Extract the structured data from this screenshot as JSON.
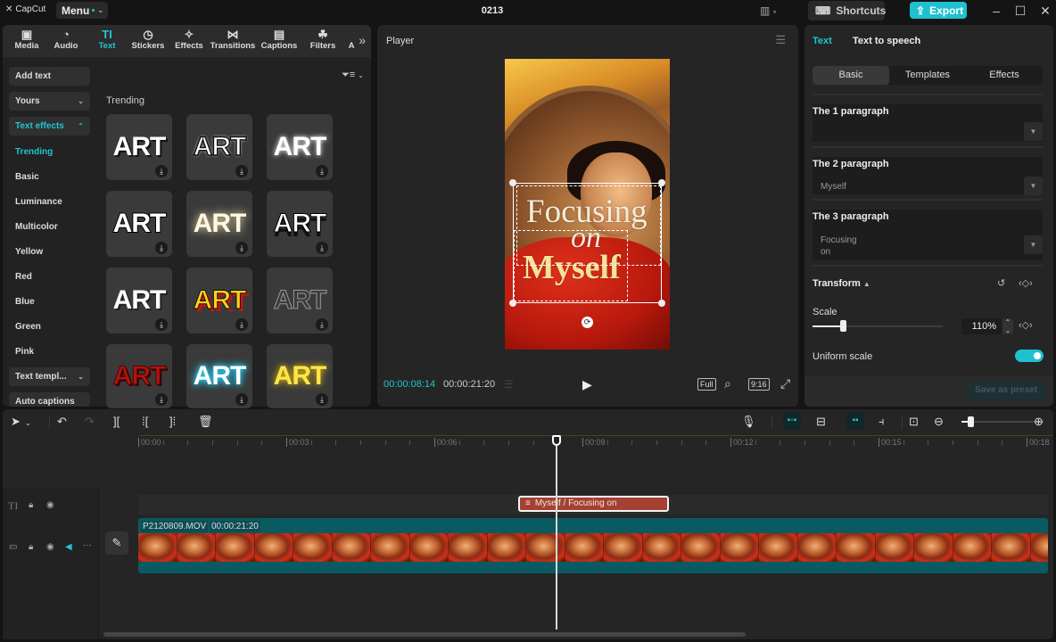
{
  "app": {
    "name": "CapCut",
    "menu_label": "Menu",
    "project_title": "0213",
    "shortcuts_label": "Shortcuts",
    "export_label": "Export",
    "accent_color": "#1fc1cf"
  },
  "toolbar": {
    "tools": [
      {
        "label": "Media",
        "icon": "media-icon",
        "glyph": "▣"
      },
      {
        "label": "Audio",
        "icon": "audio-icon",
        "glyph": "◔"
      },
      {
        "label": "Text",
        "icon": "text-icon",
        "glyph": "TI",
        "active": true
      },
      {
        "label": "Stickers",
        "icon": "stickers-icon",
        "glyph": "◷"
      },
      {
        "label": "Effects",
        "icon": "effects-icon",
        "glyph": "✧"
      },
      {
        "label": "Transitions",
        "icon": "transitions-icon",
        "glyph": "⋈"
      },
      {
        "label": "Captions",
        "icon": "captions-icon",
        "glyph": "▤"
      },
      {
        "label": "Filters",
        "icon": "filters-icon",
        "glyph": "☘"
      },
      {
        "label": "A",
        "icon": "adjustment-icon",
        "glyph": ""
      }
    ],
    "more_glyph": "»"
  },
  "text_sidebar": {
    "add_text": "Add text",
    "yours": "Yours",
    "text_effects": "Text effects",
    "categories": [
      "Trending",
      "Basic",
      "Luminance",
      "Multicolor",
      "Yellow",
      "Red",
      "Blue",
      "Green",
      "Pink"
    ],
    "active_category": "Trending",
    "text_templates": "Text templ...",
    "auto_captions": "Auto captions"
  },
  "effects_grid": {
    "section_label": "Trending",
    "items": [
      {
        "label": "ART",
        "style": "white-shadow"
      },
      {
        "label": "ART",
        "style": "black-outline"
      },
      {
        "label": "ART",
        "style": "white-glow"
      },
      {
        "label": "ART",
        "style": "black-stroke"
      },
      {
        "label": "ART",
        "style": "cream-glow"
      },
      {
        "label": "ART",
        "style": "drop-shadow"
      },
      {
        "label": "ART",
        "style": "white-bold"
      },
      {
        "label": "ART",
        "style": "yellow-red"
      },
      {
        "label": "ART",
        "style": "outline-gray"
      },
      {
        "label": "ART",
        "style": "red-dark"
      },
      {
        "label": "ART",
        "style": "cyan-glow"
      },
      {
        "label": "ART",
        "style": "yellow-glow"
      }
    ]
  },
  "player": {
    "title": "Player",
    "overlay_lines": [
      "Focusing",
      "on",
      "Myself"
    ],
    "current_time": "00:00:08:14",
    "total_time": "00:00:21:20",
    "full_label": "Full",
    "ratio_label": "9:16"
  },
  "properties": {
    "tabs": [
      "Text",
      "Text to speech"
    ],
    "active_tab": "Text",
    "sub_tabs": [
      "Basic",
      "Templates",
      "Effects"
    ],
    "active_sub_tab": "Basic",
    "paragraphs": [
      {
        "label": "The 1 paragraph",
        "value": ""
      },
      {
        "label": "The 2 paragraph",
        "value": "Myself"
      },
      {
        "label": "The 3 paragraph",
        "value": "Focusing\non"
      }
    ],
    "transform_label": "Transform",
    "scale_label": "Scale",
    "scale_value": "110%",
    "scale_fraction": 0.23,
    "uniform_scale_label": "Uniform scale",
    "uniform_scale_on": true,
    "save_preset_label": "Save as preset"
  },
  "timeline": {
    "ruler_labels": [
      "00:00",
      "00:03",
      "00:06",
      "00:09",
      "00:12",
      "00:15",
      "00:18"
    ],
    "playhead_time": "00:08:14",
    "text_clip_label": "Myself / Focusing on",
    "video_clip_name": "P2120809.MOV",
    "video_clip_duration": "00:00:21:20",
    "zoom_fraction": 0.15
  }
}
